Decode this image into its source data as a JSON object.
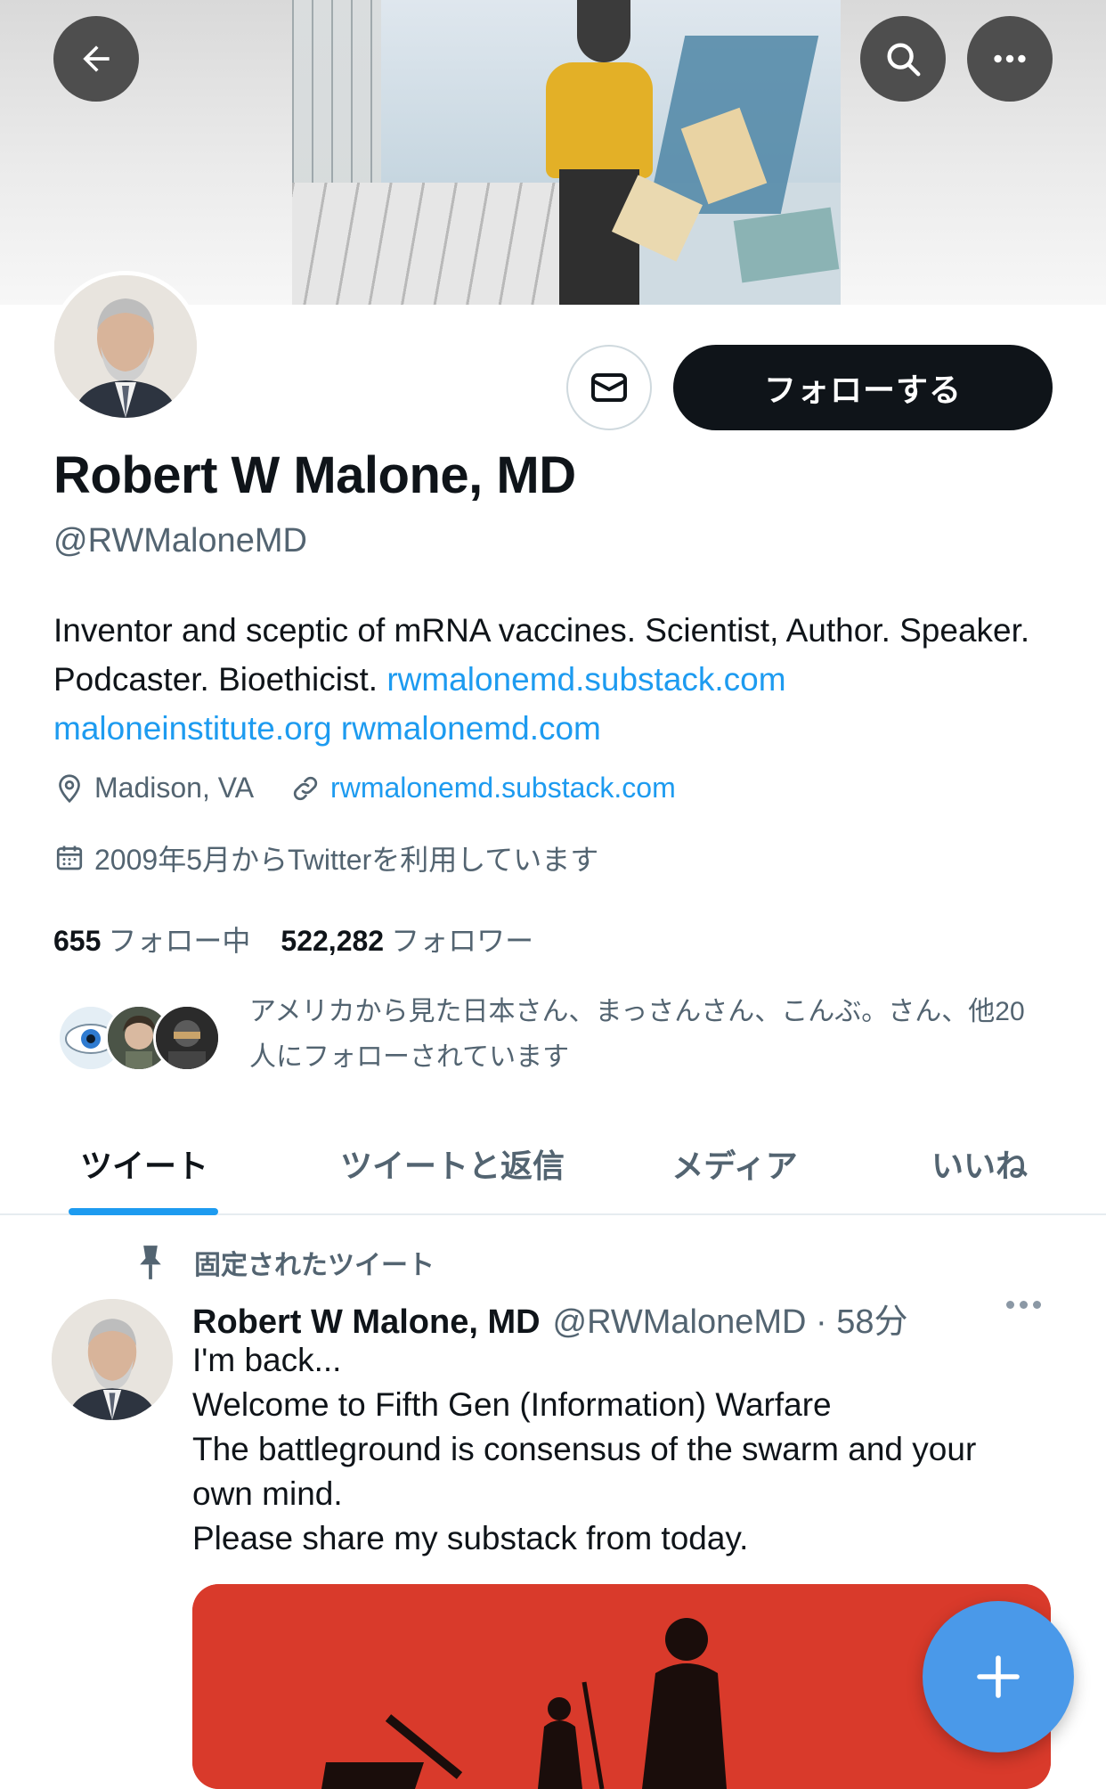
{
  "banner": {
    "icons": [
      "back-arrow-icon",
      "search-icon",
      "more-icon"
    ]
  },
  "profile": {
    "display_name": "Robert W Malone, MD",
    "handle": "@RWMaloneMD",
    "bio_text": "Inventor and sceptic of mRNA vaccines. Scientist, Author. Speaker. Podcaster. Bioethicist. ",
    "bio_links": [
      "rwmalonemd.substack.com",
      "maloneinstitute.org",
      "rwmalonemd.com"
    ],
    "location": "Madison, VA",
    "website": "rwmalonemd.substack.com",
    "joined": "2009年5月からTwitterを利用しています",
    "following_count": "655",
    "following_label": "フォロー中",
    "followers_count": "522,282",
    "followers_label": "フォロワー",
    "followed_by": "アメリカから見た日本さん、まっさんさん、こんぶ。さん、他20人にフォローされています",
    "follow_button": "フォローする",
    "message_icon": "envelope-icon"
  },
  "tabs": [
    {
      "label": "ツイート",
      "active": true
    },
    {
      "label": "ツイートと返信",
      "active": false
    },
    {
      "label": "メディア",
      "active": false
    },
    {
      "label": "いいね",
      "active": false
    }
  ],
  "tweet": {
    "pinned_label": "固定されたツイート",
    "author_name": "Robert W Malone, MD",
    "author_handle": "@RWMaloneMD",
    "time": "58分",
    "lines": [
      "I'm back...",
      "Welcome to Fifth Gen (Information) Warfare",
      "The battleground is consensus of the swarm and your own mind.",
      "Please share my substack from today."
    ]
  },
  "colors": {
    "accent": "#1d9bf0",
    "dark": "#0f1419",
    "muted": "#536471",
    "fab": "#4a99e9",
    "media": "#d93a2b"
  },
  "fab": {
    "icon": "plus-icon"
  }
}
